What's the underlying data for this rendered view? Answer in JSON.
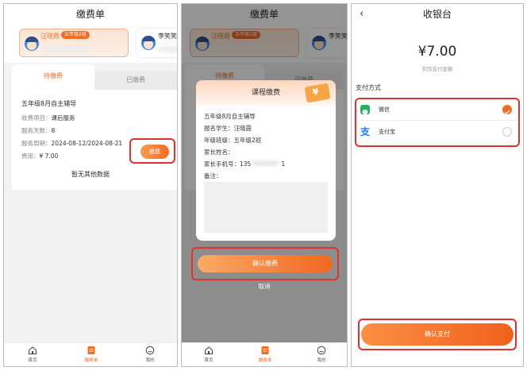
{
  "screen1": {
    "title": "缴费单",
    "student_active": {
      "name": "汪晓霞",
      "grade": "五年级2班"
    },
    "student_other": {
      "name": "李笑笑"
    },
    "tabs": {
      "pending": "待缴费",
      "paid": "已缴费"
    },
    "bill": {
      "name": "五年级8月自主辅导",
      "item_label": "收费项目：",
      "item_value": "课后服务",
      "days_label": "服务天数：",
      "days_value": "8",
      "period_label": "服务周期：",
      "period_value": "2024-08-12/2024-08-21",
      "fee_label": "费用：",
      "fee_value": "¥ 7.00"
    },
    "pay_button": "缴费",
    "no_data": "暂无其他数据"
  },
  "screen2": {
    "title": "缴费单",
    "student_active": {
      "name": "汪晓霞",
      "grade": "五年级2班"
    },
    "student_other": {
      "name": "李笑笑"
    },
    "tabs": {
      "pending": "待缴费",
      "paid": "已缴费"
    },
    "modal": {
      "title": "课程缴费",
      "rows": [
        "五年级8月自主辅导",
        "报名学生：汪晓霞",
        "年级班级：五年级2班",
        "家长姓名：",
        "家长手机号：135",
        "备注："
      ],
      "phone_tail": "1"
    },
    "confirm_button": "确认缴费",
    "cancel": "取消"
  },
  "tabbar": {
    "home": "首页",
    "bills": "缴费单",
    "mine": "我的"
  },
  "screen3": {
    "title": "收银台",
    "back_icon": "‹",
    "amount": "¥7.00",
    "amount_label": "实际支付金额",
    "section": "支付方式",
    "options": [
      {
        "label": "微信"
      },
      {
        "label": "支付宝"
      }
    ],
    "confirm_button": "确认支付"
  },
  "colors": {
    "accent": "#f06c22",
    "highlight": "#e0322c",
    "wechat": "#2aae67",
    "alipay": "#1677ff"
  }
}
